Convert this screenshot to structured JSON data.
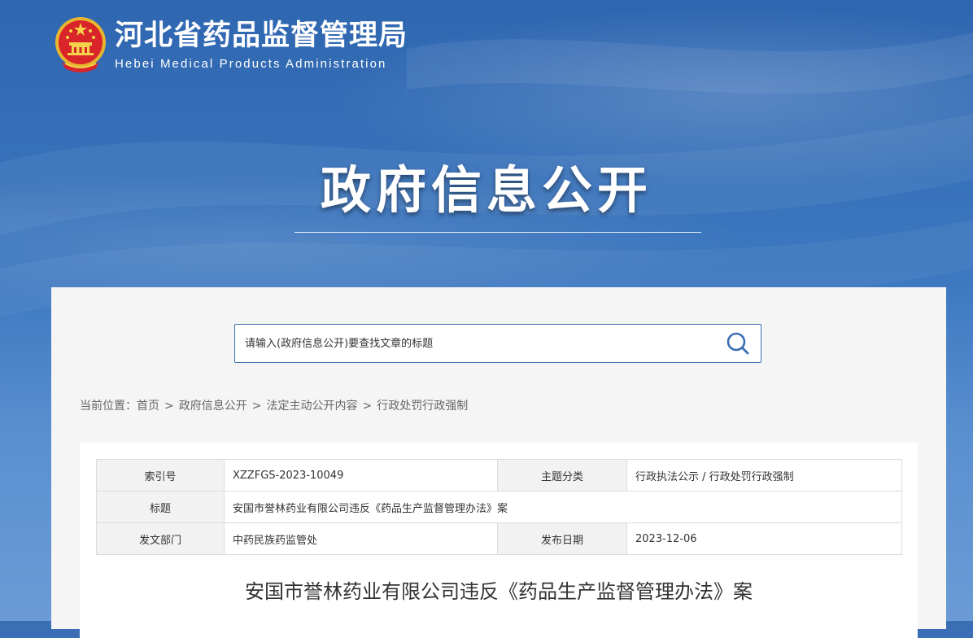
{
  "header": {
    "site_name": "河北省药品监督管理局",
    "site_name_en": "Hebei Medical Products Administration",
    "emblem_icon": "national-emblem-icon"
  },
  "hero": {
    "title": "政府信息公开"
  },
  "search": {
    "placeholder": "请输入(政府信息公开)要查找文章的标题",
    "icon": "search-icon",
    "accent_color": "#3b6db4"
  },
  "breadcrumb": {
    "prefix": "当前位置：",
    "separator": ">",
    "items": [
      "首页",
      "政府信息公开",
      "法定主动公开内容",
      "行政处罚行政强制"
    ]
  },
  "meta_table": {
    "index_label": "索引号",
    "index_value": "XZZFGS-2023-10049",
    "topic_label": "主题分类",
    "topic_value": "行政执法公示 / 行政处罚行政强制",
    "title_label": "标题",
    "title_value": "安国市誉林药业有限公司违反《药品生产监督管理办法》案",
    "dept_label": "发文部门",
    "dept_value": "中药民族药监管处",
    "date_label": "发布日期",
    "date_value": "2023-12-06"
  },
  "article": {
    "title": "安国市誉林药业有限公司违反《药品生产监督管理办法》案"
  }
}
